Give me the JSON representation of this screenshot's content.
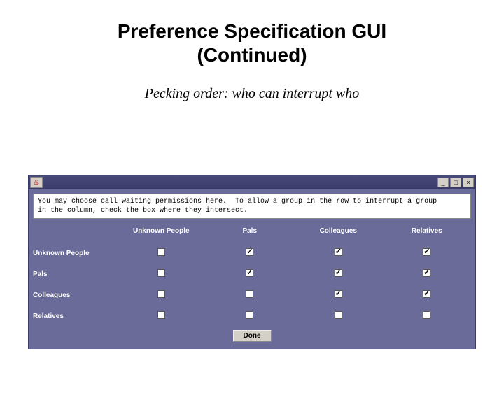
{
  "slide": {
    "title_line1": "Preference Specification GUI",
    "title_line2": "(Continued)",
    "subtitle": "Pecking order: who can interrupt who"
  },
  "instructions": "You may choose call waiting permissions here.  To allow a group in the row to interrupt a group\nin the column, check the box where they intersect.",
  "columns": [
    "Unknown People",
    "Pals",
    "Colleagues",
    "Relatives"
  ],
  "rows": [
    {
      "label": "Unknown People",
      "checks": [
        false,
        true,
        true,
        true
      ]
    },
    {
      "label": "Pals",
      "checks": [
        false,
        true,
        true,
        true
      ]
    },
    {
      "label": "Colleagues",
      "checks": [
        false,
        false,
        true,
        true
      ]
    },
    {
      "label": "Relatives",
      "checks": [
        false,
        false,
        false,
        false
      ]
    }
  ],
  "done_label": "Done",
  "java_icon_text": "♨"
}
